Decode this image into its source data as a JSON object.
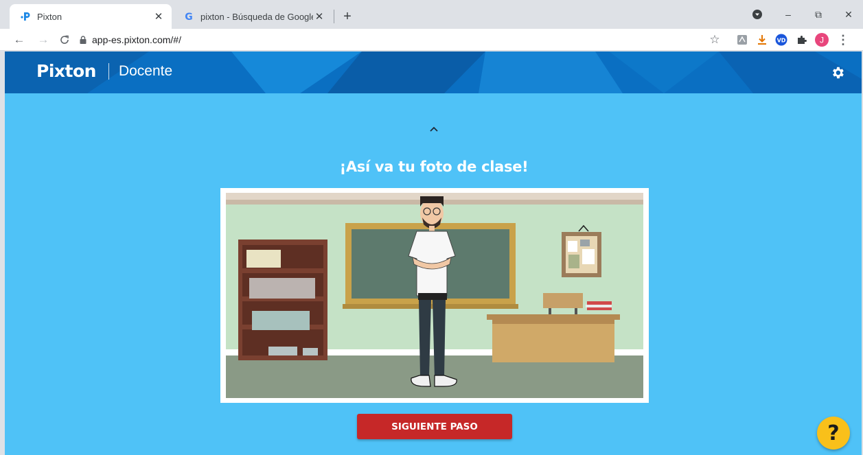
{
  "browser": {
    "tabs": [
      {
        "title": "Pixton",
        "icon": "pixton-favicon",
        "active": true
      },
      {
        "title": "pixton - Búsqueda de Google",
        "icon": "google-favicon",
        "active": false
      }
    ],
    "new_tab_label": "+",
    "window_controls": {
      "minimize": "–",
      "restore": "⧉",
      "close": "✕"
    },
    "url": "app-es.pixton.com/#/",
    "profile_initial": "J",
    "ext_vd_label": "VD"
  },
  "app": {
    "brand": "Pixton",
    "role": "Docente",
    "heading": "¡Así va tu foto de clase!",
    "next_button": "SIGUIENTE PASO",
    "help_button": "?",
    "colors": {
      "background": "#4fc2f7",
      "header": "#0a6fc2",
      "primary_button": "#c62828",
      "help_button": "#f9c01a"
    }
  }
}
